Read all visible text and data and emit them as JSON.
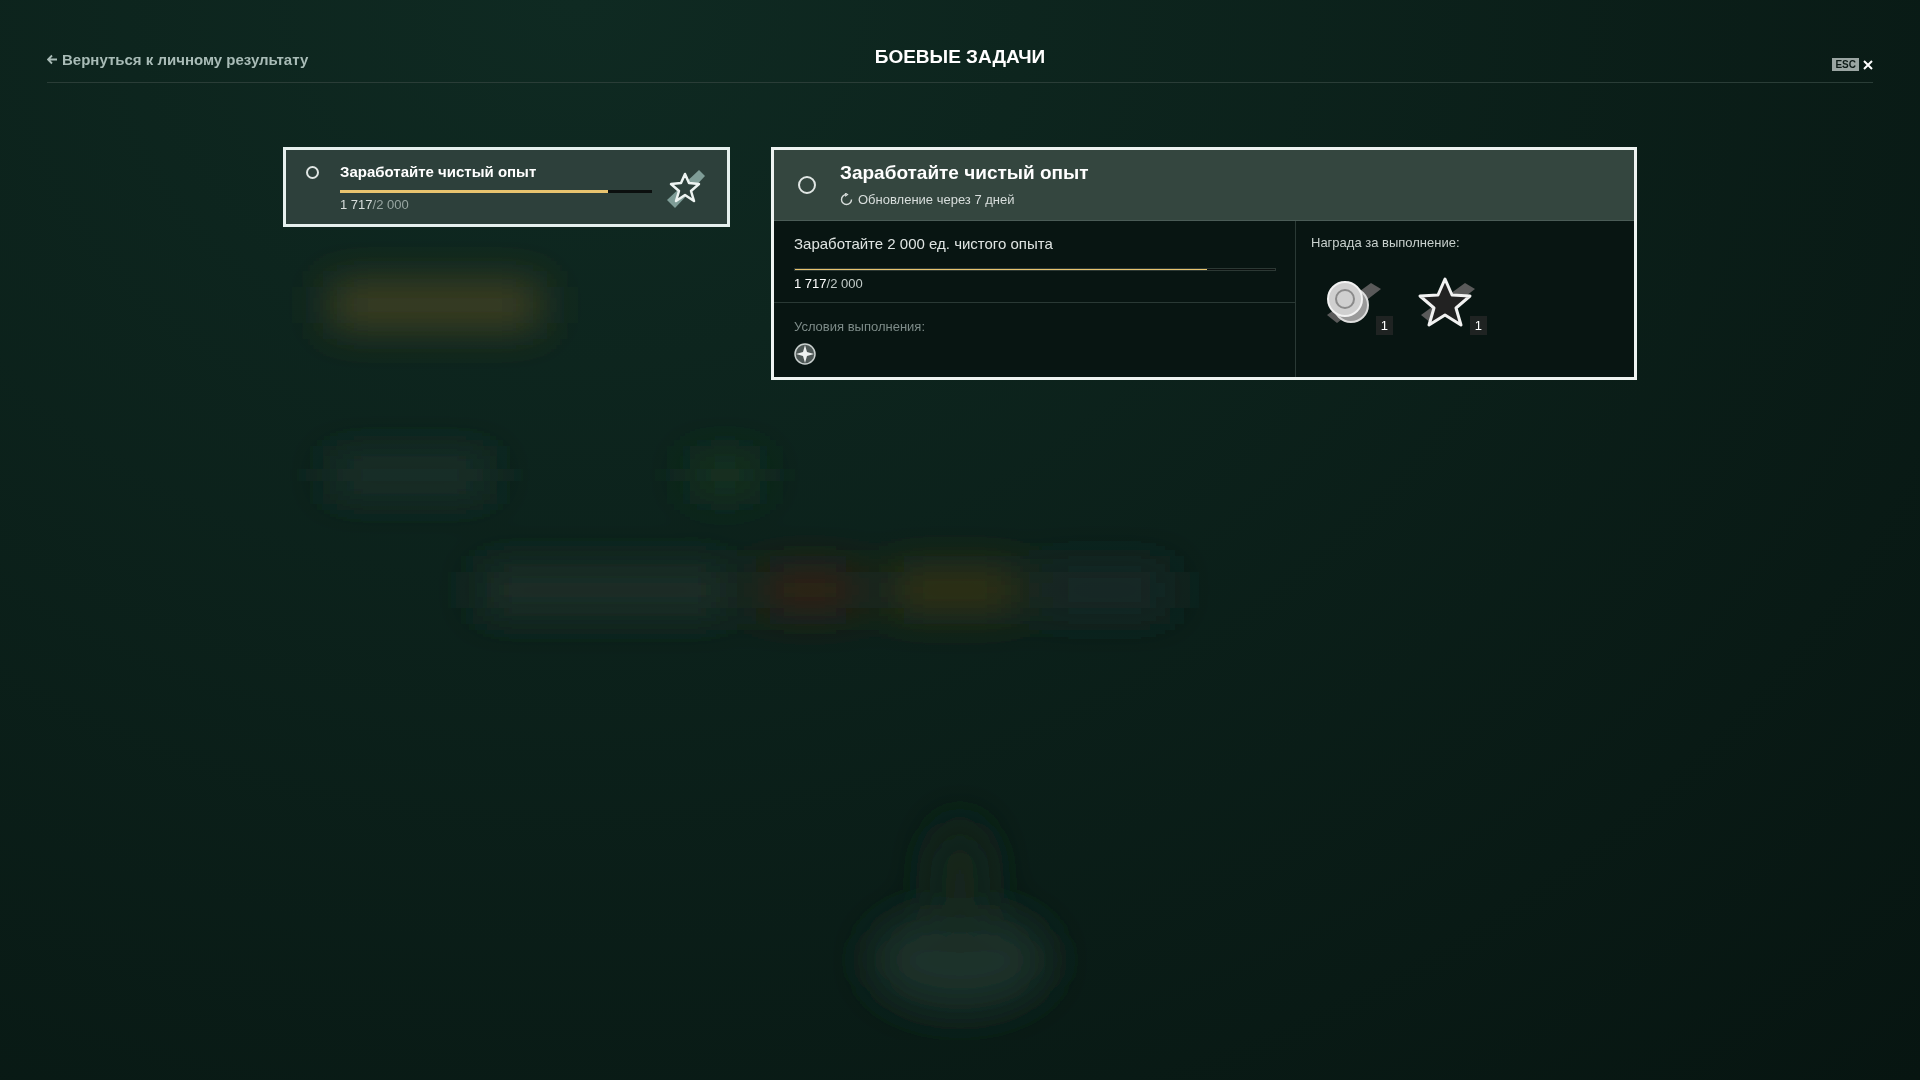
{
  "header": {
    "back_link": "Вернуться к личному результату",
    "title": "БОЕВЫЕ ЗАДАЧИ",
    "esc_key": "ESC"
  },
  "task_list": [
    {
      "title": "Заработайте чистый опыт",
      "selected": true,
      "completed": false,
      "level": 0.8585,
      "current": "1 717",
      "total": "/2 000"
    }
  ],
  "task_detail": {
    "title": "Заработайте чистый опыт",
    "completed": false,
    "refresh": "Обновление через 7 дней",
    "objective": "Заработайте 2 000 ед. чистого опыта",
    "level": 0.8585,
    "current": "1 717",
    "total": "/2 000",
    "conditions_label": "Условия выполнения:",
    "reward_label": "Награда за выполнение:",
    "rewards": [
      {
        "kind": "coins",
        "count": "1"
      },
      {
        "kind": "star",
        "count": "1"
      }
    ]
  }
}
